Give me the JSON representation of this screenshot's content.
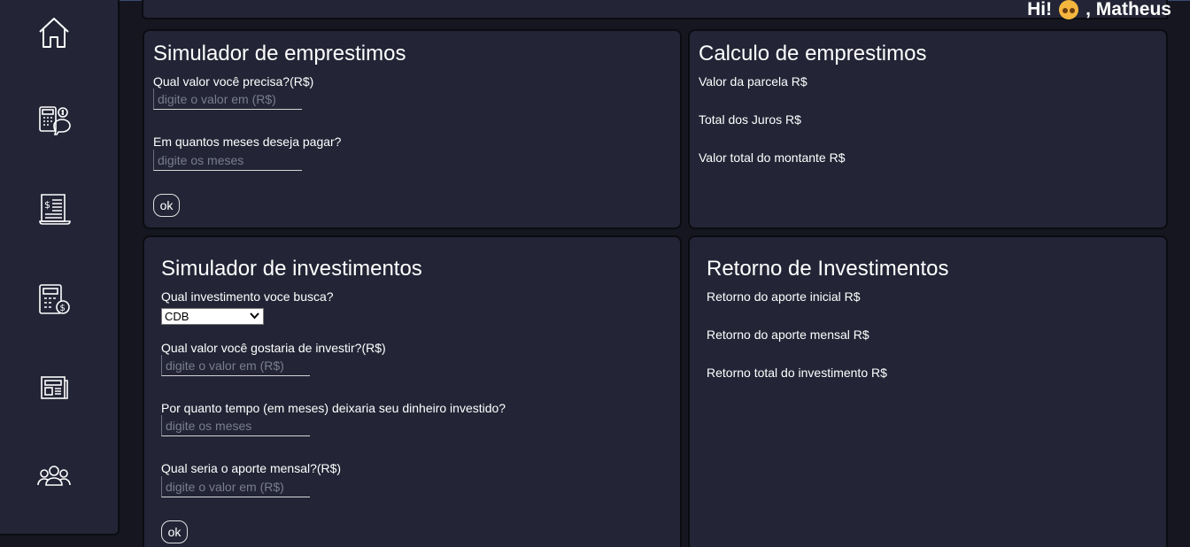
{
  "header": {
    "greeting_hi": "Hi!",
    "greeting_name": ", Matheus"
  },
  "sidebar": {
    "items": [
      {
        "icon": "home-icon"
      },
      {
        "icon": "calculator-piggy-icon"
      },
      {
        "icon": "invoice-icon"
      },
      {
        "icon": "calculator-coin-icon"
      },
      {
        "icon": "newspaper-icon"
      },
      {
        "icon": "users-icon"
      }
    ]
  },
  "loan_simulator": {
    "title": "Simulador de emprestimos",
    "amount_label": "Qual valor você precisa?(R$)",
    "amount_placeholder": "digite o valor em (R$)",
    "months_label": "Em quantos meses deseja pagar?",
    "months_placeholder": "digite os meses",
    "submit_label": "ok"
  },
  "loan_calc": {
    "title": "Calculo de emprestimos",
    "installment": "Valor da parcela R$",
    "interest": "Total dos Juros R$",
    "total": "Valor total do montante R$"
  },
  "investment_simulator": {
    "title": "Simulador de investimentos",
    "type_label": "Qual investimento voce busca?",
    "type_selected": "CDB",
    "amount_label": "Qual valor você gostaria de investir?(R$)",
    "amount_placeholder": "digite o valor em (R$)",
    "months_label": "Por quanto tempo (em meses) deixaria seu dinheiro investido?",
    "months_placeholder": "digite os meses",
    "monthly_label": "Qual seria o aporte mensal?(R$)",
    "monthly_placeholder": "digite o valor em (R$)",
    "submit_label": "ok"
  },
  "investment_return": {
    "title": "Retorno de Investimentos",
    "initial": "Retorno do aporte inicial R$",
    "monthly": "Retorno do aporte mensal R$",
    "total": "Retorno total do investimento R$"
  },
  "colors": {
    "background": "#15161f",
    "panel": "#232536",
    "text": "#ffffff"
  }
}
